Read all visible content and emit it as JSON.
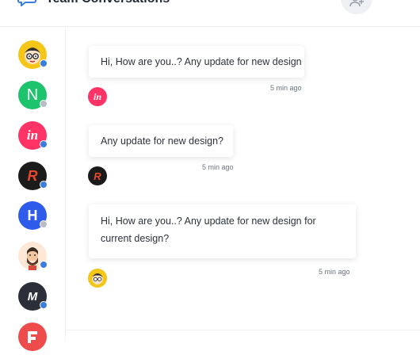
{
  "header": {
    "title": "Team Conversations",
    "icons": {
      "chat": "chat-bubble-icon",
      "add_user": "add-user-icon",
      "more": "more-dots-icon"
    }
  },
  "sidebar": {
    "contacts": [
      {
        "name": "cartoon-glasses",
        "status": "online",
        "color": "#f5c518"
      },
      {
        "name": "N-logo",
        "status": "offline",
        "color": "#1ec36e",
        "letter": "N"
      },
      {
        "name": "invision",
        "status": "online",
        "color": "#ff3366",
        "letter": "in"
      },
      {
        "name": "R-logo",
        "status": "online",
        "color": "#1b1b1b",
        "letter": "R"
      },
      {
        "name": "H-logo",
        "status": "offline",
        "color": "#2f5bea",
        "letter": "H"
      },
      {
        "name": "bearded-man",
        "status": "online",
        "color": "#fde8d7"
      },
      {
        "name": "M-logo",
        "status": "online",
        "color": "#2a2f3a",
        "letter": "M"
      },
      {
        "name": "red-logo",
        "status": "online",
        "color": "#ee4b4b"
      }
    ]
  },
  "messages": [
    {
      "text": "Hi, How are you..? Any update for new design",
      "time": "5 min ago",
      "sender_icon": "invision-avatar-icon"
    },
    {
      "text": "Any update for new design?",
      "time": "5 min ago",
      "sender_icon": "r-logo-avatar-icon"
    },
    {
      "text": "Hi, How are you..? Any update for new design for current design?",
      "time": "5 min ago",
      "sender_icon": "cartoon-avatar-icon"
    }
  ],
  "colors": {
    "online": "#3b7ddd",
    "offline": "#b8bcc6",
    "border": "#eef0f4"
  }
}
